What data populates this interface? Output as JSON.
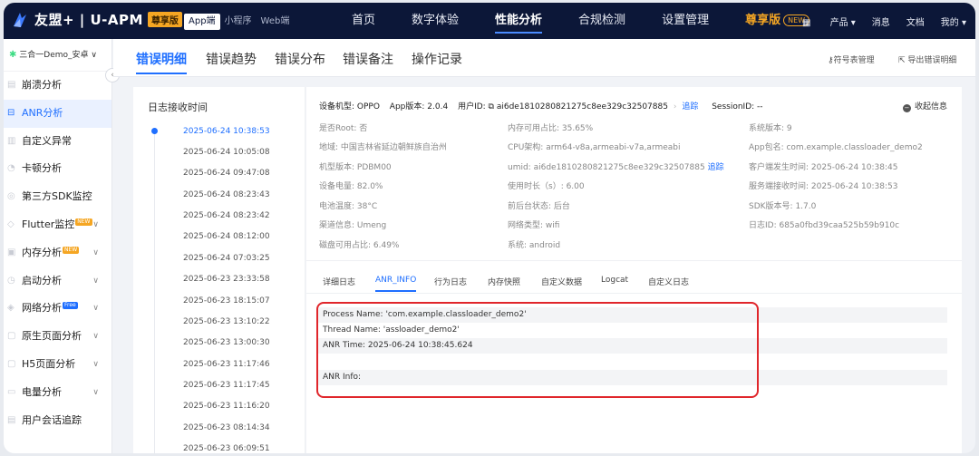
{
  "topnav": {
    "brand": "友盟+ | U-APM",
    "premium_badge": "尊享版",
    "platforms": [
      "App端",
      "小程序",
      "Web端"
    ],
    "menu": [
      "首页",
      "数字体验",
      "性能分析",
      "合规检测",
      "设置管理"
    ],
    "premium_menu": "尊享版",
    "new_pill": "NEW",
    "products": "产品 ▾",
    "messages": "消息",
    "docs": "文档",
    "mine": "我的 ▾"
  },
  "sidebar": {
    "app": "三合一Demo_安卓",
    "items": [
      {
        "label": "崩溃分析"
      },
      {
        "label": "ANR分析"
      },
      {
        "label": "自定义异常"
      },
      {
        "label": "卡顿分析"
      },
      {
        "label": "第三方SDK监控"
      },
      {
        "label": "Flutter监控",
        "badge": "NEW"
      },
      {
        "label": "内存分析",
        "badge": "NEW"
      },
      {
        "label": "启动分析"
      },
      {
        "label": "网络分析",
        "badge": "Free"
      },
      {
        "label": "原生页面分析"
      },
      {
        "label": "H5页面分析"
      },
      {
        "label": "电量分析"
      },
      {
        "label": "用户会话追踪"
      }
    ]
  },
  "tabs": [
    "错误明细",
    "错误趋势",
    "错误分布",
    "错误备注",
    "操作记录"
  ],
  "tools": {
    "symbols": "符号表管理",
    "export": "导出错误明细"
  },
  "log": {
    "title": "日志接收时间",
    "times": [
      "2025-06-24 10:38:53",
      "2025-06-24 10:05:08",
      "2025-06-24 09:47:08",
      "2025-06-24 08:23:43",
      "2025-06-24 08:23:42",
      "2025-06-24 08:12:00",
      "2025-06-24 07:03:25",
      "2025-06-23 23:33:58",
      "2025-06-23 18:15:07",
      "2025-06-23 13:10:22",
      "2025-06-23 13:00:30",
      "2025-06-23 11:17:46",
      "2025-06-23 11:17:45",
      "2025-06-23 11:16:20",
      "2025-06-23 08:14:34",
      "2025-06-23 06:09:51"
    ]
  },
  "info": {
    "device_model": "设备机型: OPPO",
    "app_version": "App版本: 2.0.4",
    "user_id_label": "用户ID: ",
    "user_id": "ai6de1810280821275c8ee329c32507885",
    "track": "追踪",
    "session": "SessionID: --",
    "collapse": "收起信息",
    "col1": [
      "是否Root: 否",
      "地域: 中国吉林省延边朝鲜族自治州",
      "机型版本: PDBM00",
      "设备电量: 82.0%",
      "电池温度: 38°C",
      "渠道信息: Umeng",
      "磁盘可用占比: 6.49%"
    ],
    "col2": [
      "内存可用占比: 35.65%",
      "CPU架构: arm64-v8a,armeabi-v7a,armeabi",
      "umid: ai6de1810280821275c8ee329c32507885",
      "使用时长（s）: 6.00",
      "前后台状态: 后台",
      "网络类型: wifi",
      "系统: android"
    ],
    "umid_track": "追踪",
    "col3": [
      "系统版本: 9",
      "App包名: com.example.classloader_demo2",
      "客户端发生时间: 2025-06-24 10:38:45",
      "服务端接收时间: 2025-06-24 10:38:53",
      "SDK版本号: 1.7.0",
      "日志ID: 685a0fbd39caa525b59b910c"
    ]
  },
  "subtabs": [
    "详细日志",
    "ANR_INFO",
    "行为日志",
    "内存快照",
    "自定义数据",
    "Logcat",
    "自定义日志"
  ],
  "anr": {
    "process": "Process Name: 'com.example.classloader_demo2'",
    "thread": "Thread Name: 'assloader_demo2'",
    "time": "ANR Time: 2025-06-24 10:38:45.624",
    "blank": "",
    "info": "ANR Info:"
  },
  "colors": {
    "nav_bg": "#0c1738",
    "accent": "#1f6fff",
    "premium": "#f5a623",
    "highlight": "#e0262b"
  }
}
